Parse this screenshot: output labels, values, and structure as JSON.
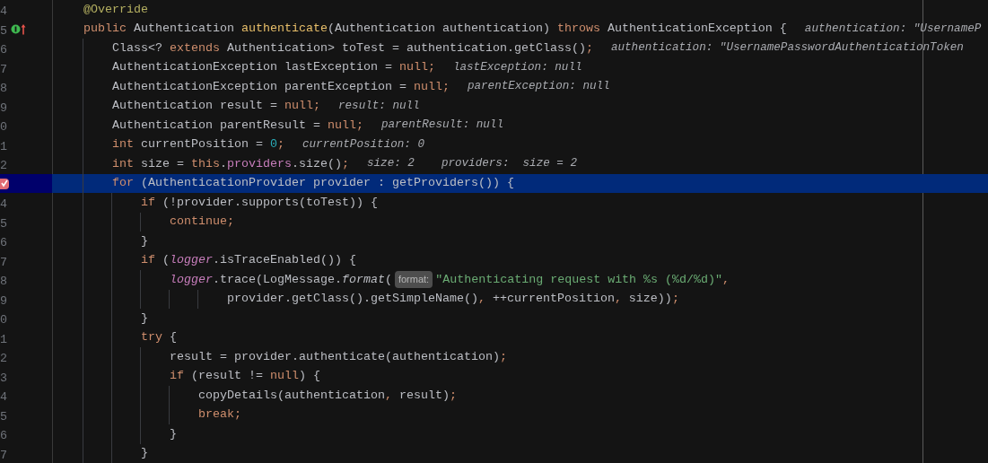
{
  "editor": {
    "lines": [
      {
        "num": "4",
        "tokens": [
          {
            "kind": "annotation",
            "text": "    @Override"
          }
        ]
      },
      {
        "num": "5",
        "implements_marker": true,
        "overrides_marker": true,
        "tokens": [
          {
            "kind": "keyword",
            "text": "    public"
          },
          {
            "kind": "plain",
            "text": " Authentication "
          },
          {
            "kind": "declaration",
            "text": "authenticate"
          },
          {
            "kind": "plain",
            "text": "(Authentication authentication) "
          },
          {
            "kind": "keyword",
            "text": "throws"
          },
          {
            "kind": "plain",
            "text": " AuthenticationException {"
          },
          {
            "kind": "hint",
            "text": "authentication: \"UsernameP"
          }
        ]
      },
      {
        "num": "6",
        "tokens": [
          {
            "kind": "plain",
            "text": "        Class<? "
          },
          {
            "kind": "keyword",
            "text": "extends"
          },
          {
            "kind": "plain",
            "text": " Authentication> toTest = authentication.getClass()"
          },
          {
            "kind": "punct",
            "text": ";"
          },
          {
            "kind": "hint",
            "text": "authentication: \"UsernamePasswordAuthenticationToken"
          }
        ]
      },
      {
        "num": "7",
        "tokens": [
          {
            "kind": "plain",
            "text": "        AuthenticationException lastException = "
          },
          {
            "kind": "keyword",
            "text": "null;"
          },
          {
            "kind": "hint",
            "text": "lastException: null"
          }
        ]
      },
      {
        "num": "8",
        "tokens": [
          {
            "kind": "plain",
            "text": "        AuthenticationException parentException = "
          },
          {
            "kind": "keyword",
            "text": "null;"
          },
          {
            "kind": "hint",
            "text": "parentException: null"
          }
        ]
      },
      {
        "num": "9",
        "tokens": [
          {
            "kind": "plain",
            "text": "        Authentication result = "
          },
          {
            "kind": "keyword",
            "text": "null;"
          },
          {
            "kind": "hint",
            "text": "result: null"
          }
        ]
      },
      {
        "num": "0",
        "tokens": [
          {
            "kind": "plain",
            "text": "        Authentication parentResult = "
          },
          {
            "kind": "keyword",
            "text": "null;"
          },
          {
            "kind": "hint",
            "text": "parentResult: null"
          }
        ]
      },
      {
        "num": "1",
        "tokens": [
          {
            "kind": "keyword",
            "text": "        int"
          },
          {
            "kind": "plain",
            "text": " currentPosition = "
          },
          {
            "kind": "number",
            "text": "0"
          },
          {
            "kind": "punct",
            "text": ";"
          },
          {
            "kind": "hint",
            "text": "currentPosition: 0"
          }
        ]
      },
      {
        "num": "2",
        "tokens": [
          {
            "kind": "keyword",
            "text": "        int"
          },
          {
            "kind": "plain",
            "text": " size = "
          },
          {
            "kind": "keyword",
            "text": "this"
          },
          {
            "kind": "plain",
            "text": "."
          },
          {
            "kind": "field",
            "text": "providers"
          },
          {
            "kind": "plain",
            "text": ".size()"
          },
          {
            "kind": "punct",
            "text": ";"
          },
          {
            "kind": "hint",
            "text": "size: 2"
          },
          {
            "kind": "hint",
            "text": "providers:  size = 2"
          }
        ]
      },
      {
        "selected": true,
        "breakpoint": true,
        "tokens": [
          {
            "kind": "keyword",
            "text": "        for"
          },
          {
            "kind": "plain",
            "text": " (AuthenticationProvider provider : getProviders()) {"
          }
        ]
      },
      {
        "num": "4",
        "tokens": [
          {
            "kind": "keyword",
            "text": "            if"
          },
          {
            "kind": "plain",
            "text": " (!provider.supports(toTest)) {"
          }
        ]
      },
      {
        "num": "5",
        "tokens": [
          {
            "kind": "keyword",
            "text": "                continue;"
          }
        ]
      },
      {
        "num": "6",
        "tokens": [
          {
            "kind": "plain",
            "text": "            }"
          }
        ]
      },
      {
        "num": "7",
        "tokens": [
          {
            "kind": "keyword",
            "text": "            if"
          },
          {
            "kind": "plain",
            "text": " ("
          },
          {
            "kind": "static_field",
            "text": "logger"
          },
          {
            "kind": "plain",
            "text": ".isTraceEnabled()) {"
          }
        ]
      },
      {
        "num": "8",
        "tokens": [
          {
            "kind": "static_field",
            "text": "                logger"
          },
          {
            "kind": "plain",
            "text": ".trace(LogMessage."
          },
          {
            "kind": "static_method",
            "text": "format"
          },
          {
            "kind": "plain",
            "text": "("
          },
          {
            "kind": "badge",
            "text": "format:"
          },
          {
            "kind": "string",
            "text": "\"Authenticating request with %s (%d/%d)\""
          },
          {
            "kind": "punct",
            "text": ","
          }
        ]
      },
      {
        "num": "9",
        "tokens": [
          {
            "kind": "plain",
            "text": "                        provider.getClass().getSimpleName()"
          },
          {
            "kind": "punct",
            "text": ","
          },
          {
            "kind": "plain",
            "text": " ++currentPosition"
          },
          {
            "kind": "punct",
            "text": ","
          },
          {
            "kind": "plain",
            "text": " size))"
          },
          {
            "kind": "punct",
            "text": ";"
          }
        ]
      },
      {
        "num": "0",
        "tokens": [
          {
            "kind": "plain",
            "text": "            }"
          }
        ]
      },
      {
        "num": "1",
        "tokens": [
          {
            "kind": "keyword",
            "text": "            try"
          },
          {
            "kind": "plain",
            "text": " {"
          }
        ]
      },
      {
        "num": "2",
        "tokens": [
          {
            "kind": "plain",
            "text": "                result = provider.authenticate(authentication)"
          },
          {
            "kind": "punct",
            "text": ";"
          }
        ]
      },
      {
        "num": "3",
        "tokens": [
          {
            "kind": "keyword",
            "text": "                if"
          },
          {
            "kind": "plain",
            "text": " (result != "
          },
          {
            "kind": "keyword",
            "text": "null"
          },
          {
            "kind": "plain",
            "text": ") {"
          }
        ]
      },
      {
        "num": "4",
        "tokens": [
          {
            "kind": "plain",
            "text": "                    copyDetails(authentication"
          },
          {
            "kind": "punct",
            "text": ","
          },
          {
            "kind": "plain",
            "text": " result)"
          },
          {
            "kind": "punct",
            "text": ";"
          }
        ]
      },
      {
        "num": "5",
        "tokens": [
          {
            "kind": "keyword",
            "text": "                    break;"
          }
        ]
      },
      {
        "num": "6",
        "tokens": [
          {
            "kind": "plain",
            "text": "                }"
          }
        ]
      },
      {
        "num": "7",
        "tokens": [
          {
            "kind": "plain",
            "text": "            }"
          }
        ]
      }
    ]
  }
}
